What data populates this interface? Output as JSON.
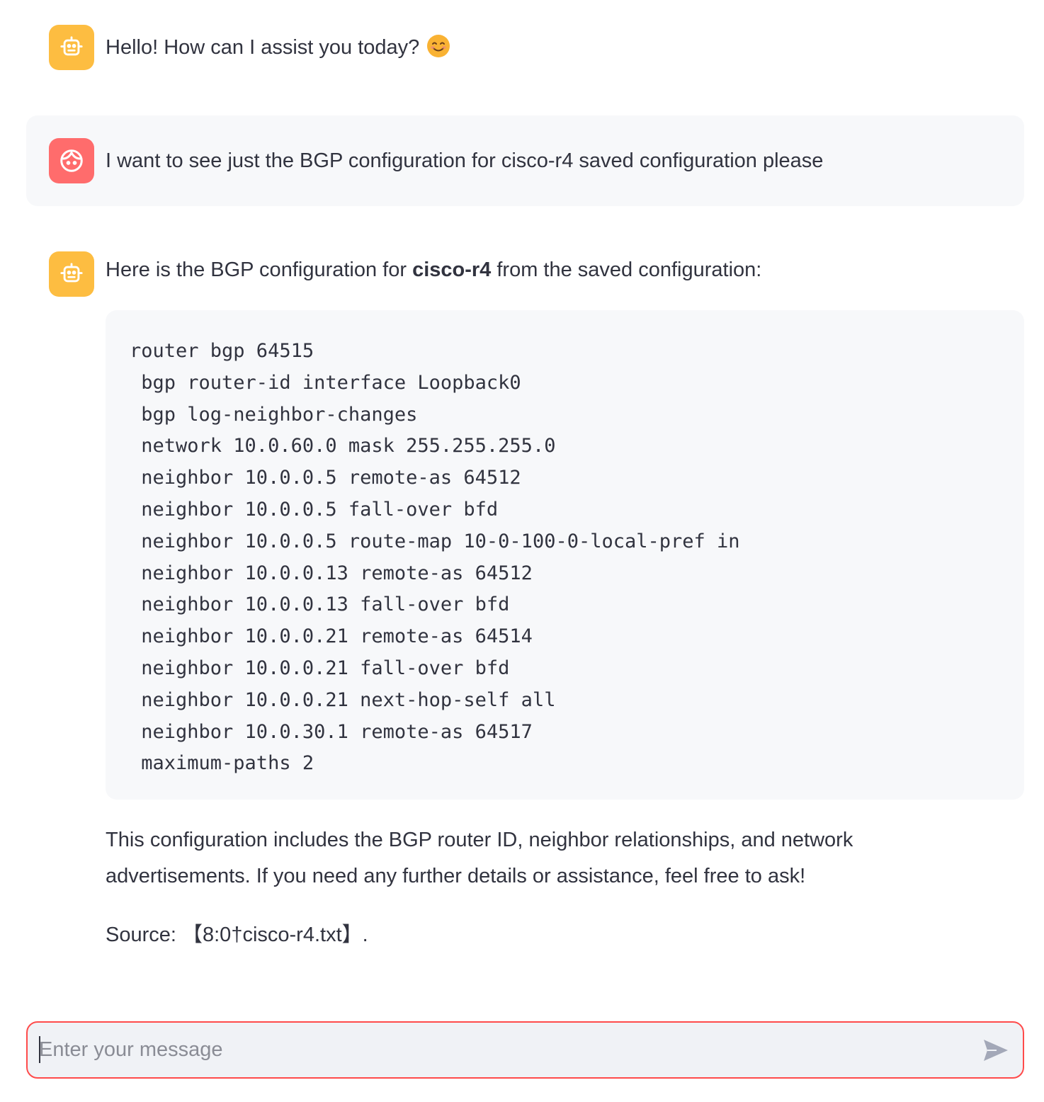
{
  "messages": [
    {
      "role": "assistant",
      "text": "Hello! How can I assist you today?",
      "emoji": "😊"
    },
    {
      "role": "user",
      "text": "I want to see just the BGP configuration for cisco-r4 saved configuration please"
    },
    {
      "role": "assistant",
      "intro_before": "Here is the BGP configuration for ",
      "intro_bold": "cisco-r4",
      "intro_after": " from the saved configuration:",
      "code_lines": [
        "router bgp 64515",
        " bgp router-id interface Loopback0",
        " bgp log-neighbor-changes",
        " network 10.0.60.0 mask 255.255.255.0",
        " neighbor 10.0.0.5 remote-as 64512",
        " neighbor 10.0.0.5 fall-over bfd",
        " neighbor 10.0.0.5 route-map 10-0-100-0-local-pref in",
        " neighbor 10.0.0.13 remote-as 64512",
        " neighbor 10.0.0.13 fall-over bfd",
        " neighbor 10.0.0.21 remote-as 64514",
        " neighbor 10.0.0.21 fall-over bfd",
        " neighbor 10.0.0.21 next-hop-self all",
        " neighbor 10.0.30.1 remote-as 64517",
        " maximum-paths 2"
      ],
      "summary_line1": "This configuration includes the BGP router ID, neighbor relationships, and network",
      "summary_line2": "advertisements. If you need any further details or assistance, feel free to ask!",
      "source": "Source: 【8:0†cisco-r4.txt】."
    }
  ],
  "input": {
    "placeholder": "Enter your message",
    "value": ""
  },
  "icons": {
    "bot_avatar": "robot-icon",
    "user_avatar": "face-icon",
    "send": "send-icon"
  },
  "colors": {
    "bot_avatar_bg": "#fdbd41",
    "user_avatar_bg": "#ff6c6c",
    "input_border": "#ff4b4b",
    "user_bubble_bg": "#f7f8fa",
    "code_bg": "#f7f8fa"
  }
}
